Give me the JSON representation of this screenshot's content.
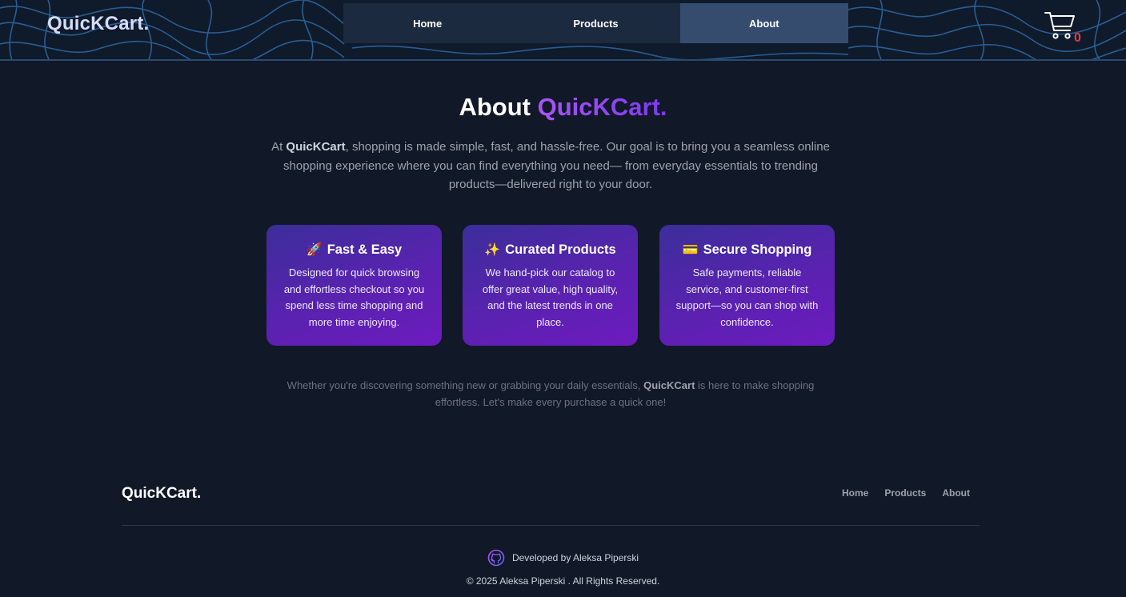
{
  "header": {
    "brand": "QuicKCart.",
    "nav": [
      {
        "label": "Home",
        "active": false
      },
      {
        "label": "Products",
        "active": false
      },
      {
        "label": "About",
        "active": true
      }
    ],
    "cart_icon": "shopping-cart-icon",
    "cart_count": "0"
  },
  "about": {
    "title_prefix": "About",
    "title_accent": "QuicKCart.",
    "intro_lead": "At",
    "intro_brand": "QuicKCart",
    "intro_rest": ", shopping is made simple, fast, and hassle-free. Our goal is to bring you a seamless online shopping experience where you can find everything you need— from everyday essentials to trending products—delivered right to your door.",
    "cards": [
      {
        "icon": "🚀",
        "icon_name": "rocket-icon",
        "title": "Fast & Easy",
        "text": "Designed for quick browsing and effortless checkout so you spend less time shopping and more time enjoying."
      },
      {
        "icon": "✨",
        "icon_name": "sparkles-icon",
        "title": "Curated Products",
        "text": "We hand-pick our catalog to offer great value, high quality, and the latest trends in one place."
      },
      {
        "icon": "💳",
        "icon_name": "credit-card-icon",
        "title": "Secure Shopping",
        "text": "Safe payments, reliable service, and customer-first support—so you can shop with confidence."
      }
    ],
    "closing_before": "Whether you're discovering something new or grabbing your daily essentials,",
    "closing_brand": "QuicKCart",
    "closing_after": "is here to make shopping effortless. Let's make every purchase a quick one!"
  },
  "footer": {
    "brand": "QuicKCart.",
    "links": [
      "Home",
      "Products",
      "About"
    ],
    "credit": "Developed by Aleksa Piperski",
    "credit_icon": "github-icon",
    "copyright": "© 2025 Aleksa Piperski . All Rights Reserved."
  },
  "colors": {
    "background": "#111827",
    "header": "#0f1a2b",
    "nav_active": "#364c6f",
    "accent": "#a855f7",
    "card_gradient_start": "#3b2e9a",
    "card_gradient_end": "#6d1bbf",
    "cart_badge": "#e53e3e"
  }
}
